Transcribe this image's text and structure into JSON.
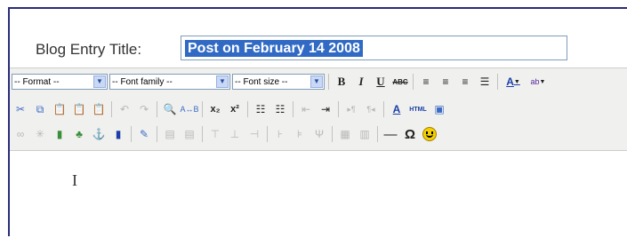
{
  "form": {
    "title_label": "Blog Entry Title:",
    "title_value": "Post on February 14 2008"
  },
  "toolbar": {
    "format_label": "-- Format --",
    "font_family_label": "-- Font family --",
    "font_size_label": "-- Font size --",
    "bold": "B",
    "italic": "I",
    "underline": "U",
    "strike": "ABC",
    "subscript": "x₂",
    "superscript": "x²",
    "html_label": "HTML",
    "hr": "—",
    "omega": "Ω"
  }
}
